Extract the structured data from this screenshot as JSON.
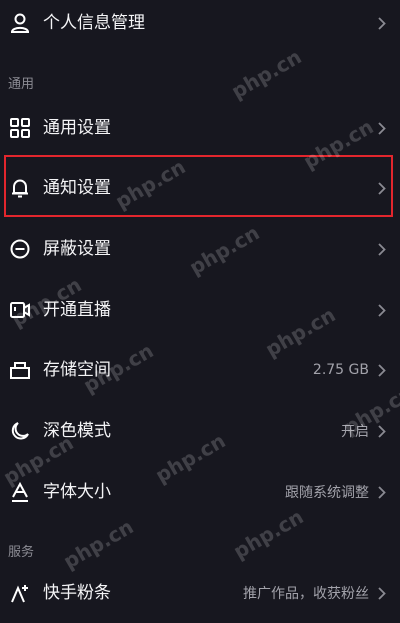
{
  "settings": {
    "profile": {
      "label": "个人信息管理",
      "icon": "person-icon"
    },
    "section_general": "通用",
    "general": {
      "label": "通用设置",
      "icon": "grid-icon"
    },
    "notifications": {
      "label": "通知设置",
      "icon": "bell-icon"
    },
    "block": {
      "label": "屏蔽设置",
      "icon": "minus-circle-icon"
    },
    "live": {
      "label": "开通直播",
      "icon": "video-icon"
    },
    "storage": {
      "label": "存储空间",
      "value": "2.75 GB",
      "icon": "storage-box-icon"
    },
    "dark_mode": {
      "label": "深色模式",
      "value": "开启",
      "icon": "moon-icon"
    },
    "font_size": {
      "label": "字体大小",
      "value": "跟随系统调整",
      "icon": "font-size-icon"
    },
    "section_services": "服务",
    "kuaishou_fans": {
      "label": "快手粉条",
      "value": "推广作品，收获粉丝",
      "icon": "fans-boost-icon"
    }
  },
  "watermark_text": "php.cn",
  "colors": {
    "background": "#17171f",
    "highlight_border": "#e3262d",
    "secondary_text": "#a2a2aa"
  }
}
